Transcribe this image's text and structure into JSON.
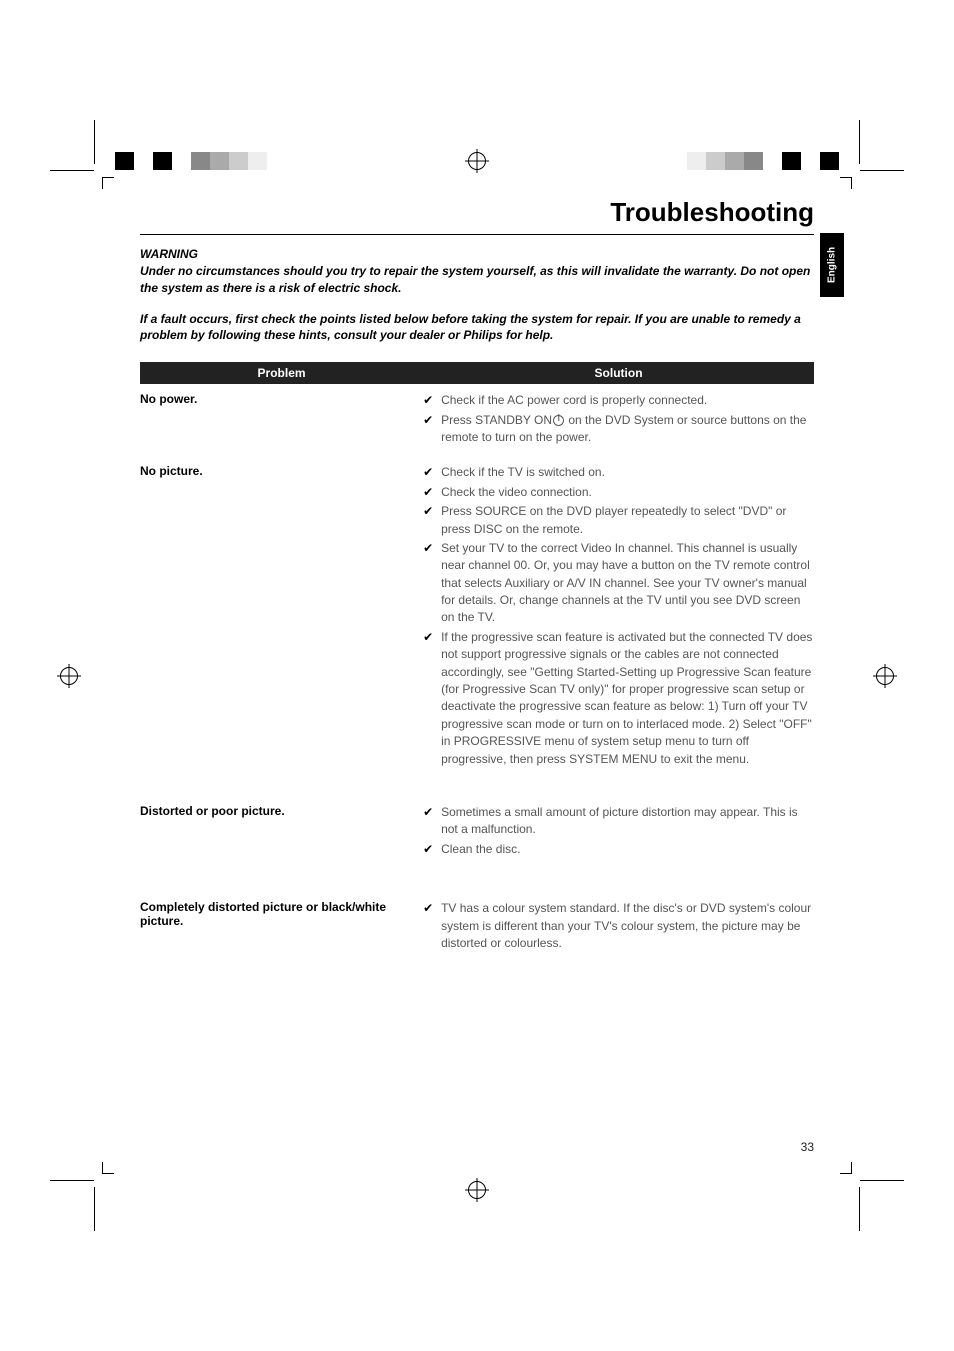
{
  "language_tab": "English",
  "title": "Troubleshooting",
  "warning": {
    "heading": "WARNING",
    "paragraph1": "Under no circumstances should you try to repair the system yourself, as this will invalidate the warranty.  Do not open the system as there is a risk of electric shock.",
    "paragraph2": "If a fault occurs, first check the points listed below before taking the system for repair. If you are unable to remedy a problem by following these hints, consult your dealer or Philips for help."
  },
  "table": {
    "header_problem": "Problem",
    "header_solution": "Solution",
    "rows": [
      {
        "problem": "No power.",
        "solutions": [
          "Check if the AC power cord is properly connected.",
          "Press STANDBY ON ⏻ on the DVD System or source buttons on the remote to turn on the power."
        ]
      },
      {
        "problem": "No picture.",
        "solutions": [
          "Check if the TV is switched on.",
          "Check the video connection.",
          "Press SOURCE on the DVD player repeatedly to select \"DVD\" or press DISC on the remote.",
          "Set your TV to the correct Video In channel. This channel is usually near channel 00. Or, you may have a button on the TV remote control that selects Auxiliary or A/V IN channel. See your TV owner's manual for details. Or, change channels at the TV until you see DVD screen on the TV.",
          "If the progressive scan feature is activated but the connected TV does not support progressive signals or the cables are not connected accordingly, see \"Getting Started-Setting up Progressive Scan feature (for Progressive Scan TV only)\" for proper progressive scan setup or deactivate the progressive scan feature as below:\n1) Turn off your TV progressive scan mode or turn on to interlaced mode.\n2) Select \"OFF\" in PROGRESSIVE menu of system setup menu to turn off progressive, then press SYSTEM MENU to exit the menu."
        ]
      },
      {
        "problem": "Distorted or poor picture.",
        "solutions": [
          "Sometimes a small amount of picture distortion may appear. This is not a malfunction.",
          "Clean the disc."
        ]
      },
      {
        "problem": "Completely distorted picture or black/white picture.",
        "solutions": [
          "TV has a colour system standard. If the disc's or DVD system's colour system is different than your TV's colour system, the picture may be distorted or colourless."
        ]
      }
    ]
  },
  "page_number": "33"
}
